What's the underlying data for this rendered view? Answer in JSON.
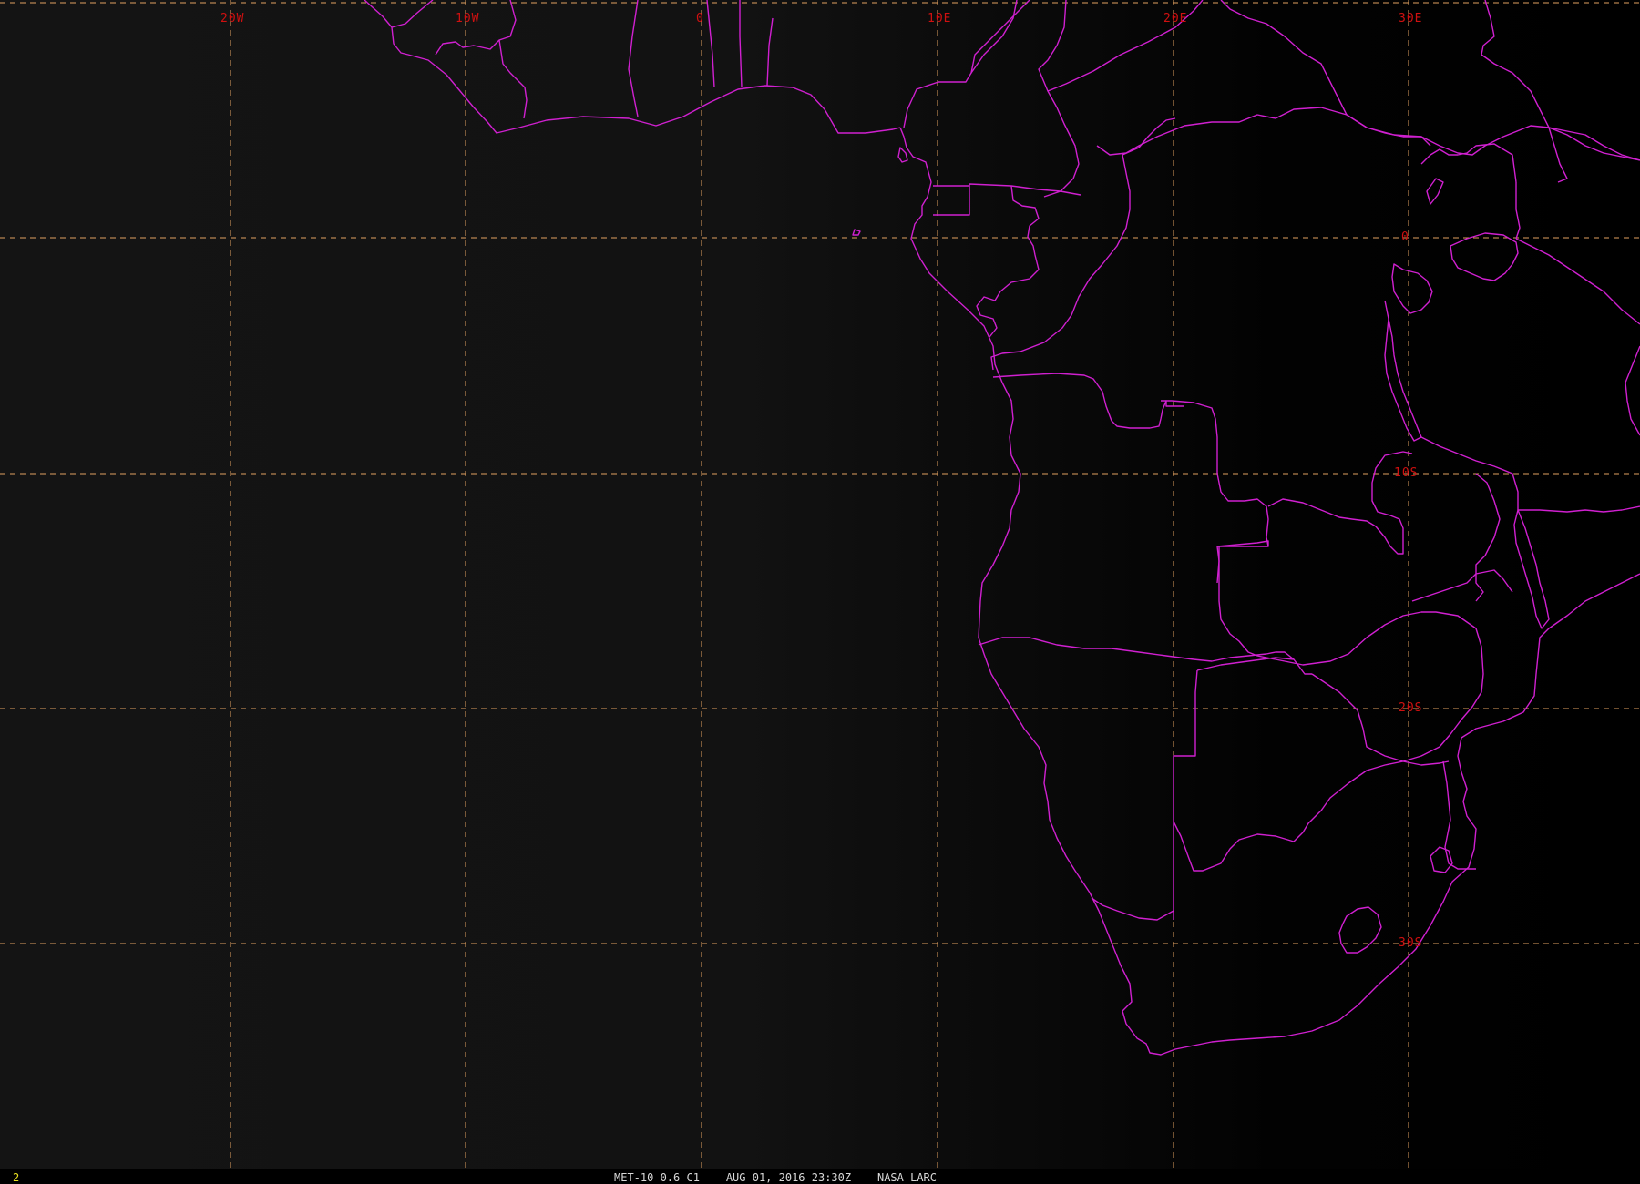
{
  "frame_number": "2",
  "caption": "MET-10 0.6 C1    AUG 01, 2016 23:30Z    NASA LARC",
  "map": {
    "longitude_labels": [
      "20W",
      "10W",
      "0",
      "10E",
      "20E",
      "30E"
    ],
    "latitude_labels": [
      "0",
      "10S",
      "20S",
      "30S"
    ],
    "colors": {
      "background": "#000000",
      "borders": "#d020d0",
      "graticule": "#e0a060",
      "graticule_labels": "#d01010",
      "frame_number": "#e8e020",
      "caption": "#d8d8d8"
    }
  }
}
